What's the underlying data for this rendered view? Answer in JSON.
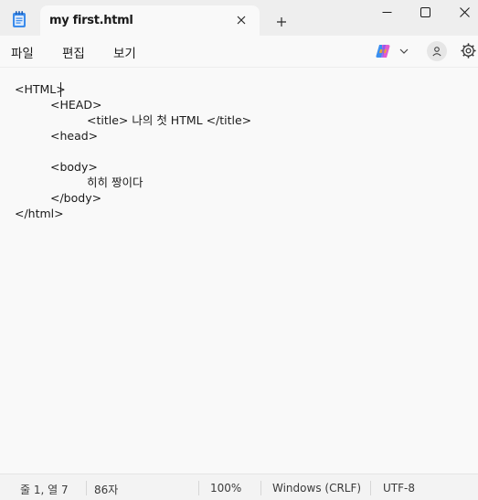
{
  "tab": {
    "title": "my first.html",
    "new_tab_symbol": "+"
  },
  "menu": {
    "file": "파일",
    "edit": "편집",
    "view": "보기"
  },
  "editor": {
    "lines": [
      "<HTML>",
      "<HEAD>",
      "<title> 나의 첫 HTML </title>",
      "<head>",
      "",
      "<body>",
      "히히 짱이다",
      "</body>",
      "</html>"
    ]
  },
  "status": {
    "position": "줄 1, 열 7",
    "chars": "86자",
    "zoom": "100%",
    "line_ending": "Windows (CRLF)",
    "encoding": "UTF-8"
  },
  "icons": {
    "app": "notepad-icon",
    "tab_close": "close-icon",
    "new_tab": "plus-icon",
    "minimize": "minimize-icon",
    "maximize": "maximize-icon",
    "close": "close-icon",
    "copilot": "copilot-icon",
    "copilot_menu": "chevron-down-icon",
    "profile": "person-icon",
    "settings": "gear-icon"
  },
  "colors": {
    "titlebar": "#eeeeee",
    "surface": "#f9f9f9",
    "statusbar": "#f3f3f3",
    "notepad_blue": "#1e6fd9"
  }
}
